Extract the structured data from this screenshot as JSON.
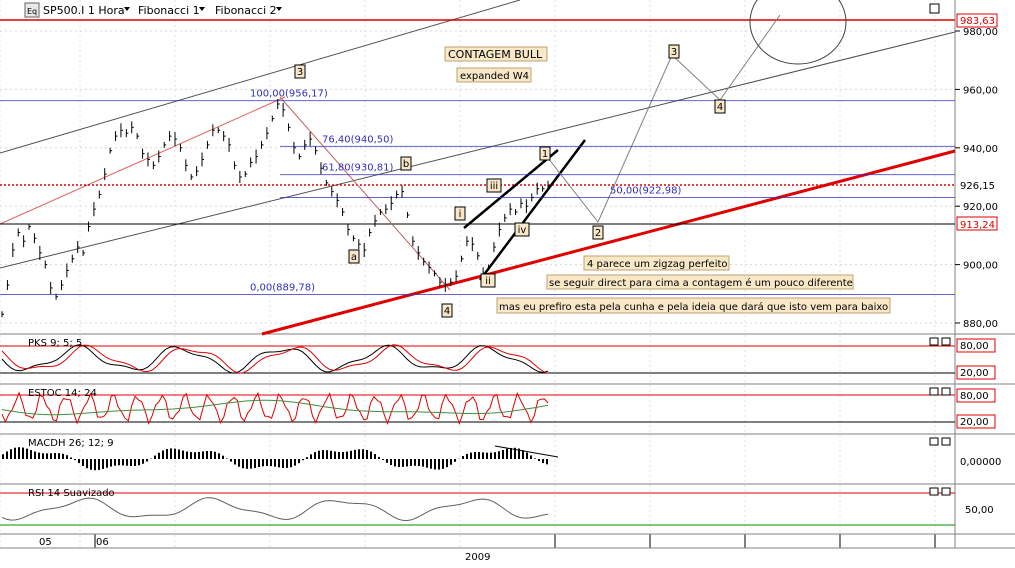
{
  "header": {
    "icon_text": "Eq",
    "symbol": "SP500.I 1 Hora",
    "menu1": "Fibonacci 1",
    "menu2": "Fibonacci 2"
  },
  "colors": {
    "grid": "#c0c0c0",
    "fib": "#3030c0",
    "red": "#e00000",
    "panel_line": "#808080",
    "box_fill": "#f8e8c8",
    "rsi_green": "#009000",
    "stoch_green": "#3f8f3f"
  },
  "chart_data": [
    {
      "type": "line",
      "name": "price",
      "title": "SP500.I 1 Hora",
      "ylim": [
        873,
        991
      ],
      "y_ticks": [
        880,
        900,
        920,
        940,
        960,
        980
      ],
      "y_tick_labels": [
        "880,00",
        "900,00",
        "920,00",
        "940,00",
        "960,00",
        "980,00"
      ],
      "x_labels": [
        "05",
        "06",
        "2009"
      ],
      "grid": true,
      "series": [
        {
          "values": [
            883,
            893,
            905,
            911,
            908,
            913,
            909,
            904,
            900,
            892,
            889,
            893,
            898,
            902,
            906,
            904,
            913,
            919,
            924,
            931,
            939,
            944,
            946,
            945,
            947,
            944,
            938,
            936,
            934,
            937,
            941,
            944,
            943,
            940,
            934,
            930,
            932,
            936,
            941,
            946,
            946,
            944,
            941,
            934,
            930,
            931,
            935,
            937,
            941,
            945,
            950,
            955,
            953,
            947,
            940,
            937,
            941,
            943,
            939,
            933,
            928,
            925,
            922,
            918,
            912,
            909,
            907,
            905,
            911,
            915,
            918,
            919,
            921,
            924,
            925,
            917,
            908,
            904,
            901,
            899,
            897,
            894,
            893,
            894,
            896,
            902,
            908,
            907,
            903,
            897,
            899,
            906,
            912,
            916,
            919,
            918,
            921,
            920,
            923,
            926,
            926,
            927
          ]
        }
      ],
      "annotations": {
        "fib_levels": [
          {
            "label": "100,00(956,17)",
            "value": 956.17
          },
          {
            "label": "76,40(940,50)",
            "value": 940.5
          },
          {
            "label": "61,80(930,81)",
            "value": 930.81
          },
          {
            "label": "50,00(922,98)",
            "value": 922.98
          },
          {
            "label": "0,00(889,78)",
            "value": 889.78
          }
        ],
        "price_tags": [
          {
            "label": "983,63",
            "value": 983.63
          },
          {
            "label": "926,15",
            "value": 926.15
          },
          {
            "label": "913,24",
            "value": 913.24
          }
        ],
        "wave_labels": [
          "3",
          "b",
          "a",
          "4",
          "iii",
          "i",
          "iv",
          "ii",
          "1",
          "2",
          "3",
          "4"
        ],
        "texts": [
          "CONTAGEM BULL",
          "expanded W4",
          "4 parece um zigzag perfeito",
          "se seguir direct para cima a contagem é um pouco diferente",
          "mas eu prefiro esta pela cunha e pela ideia que dará que isto vem para baixo"
        ]
      }
    },
    {
      "type": "line",
      "name": "PKS",
      "title": "PKS 9; 5; 5",
      "ylim": [
        0,
        100
      ],
      "y_tick_labels": [
        "80,00",
        "20,00"
      ]
    },
    {
      "type": "line",
      "name": "ESTOC",
      "title": "ESTOC 14; 24",
      "ylim": [
        0,
        100
      ],
      "y_tick_labels": [
        "80,00",
        "20,00"
      ]
    },
    {
      "type": "bar",
      "name": "MACDH",
      "title": "MACDH 26; 12; 9",
      "y_tick_labels": [
        "0,00000"
      ]
    },
    {
      "type": "line",
      "name": "RSI",
      "title": "RSI 14 Suavizado",
      "y_tick_labels": [
        "50,00"
      ]
    }
  ]
}
